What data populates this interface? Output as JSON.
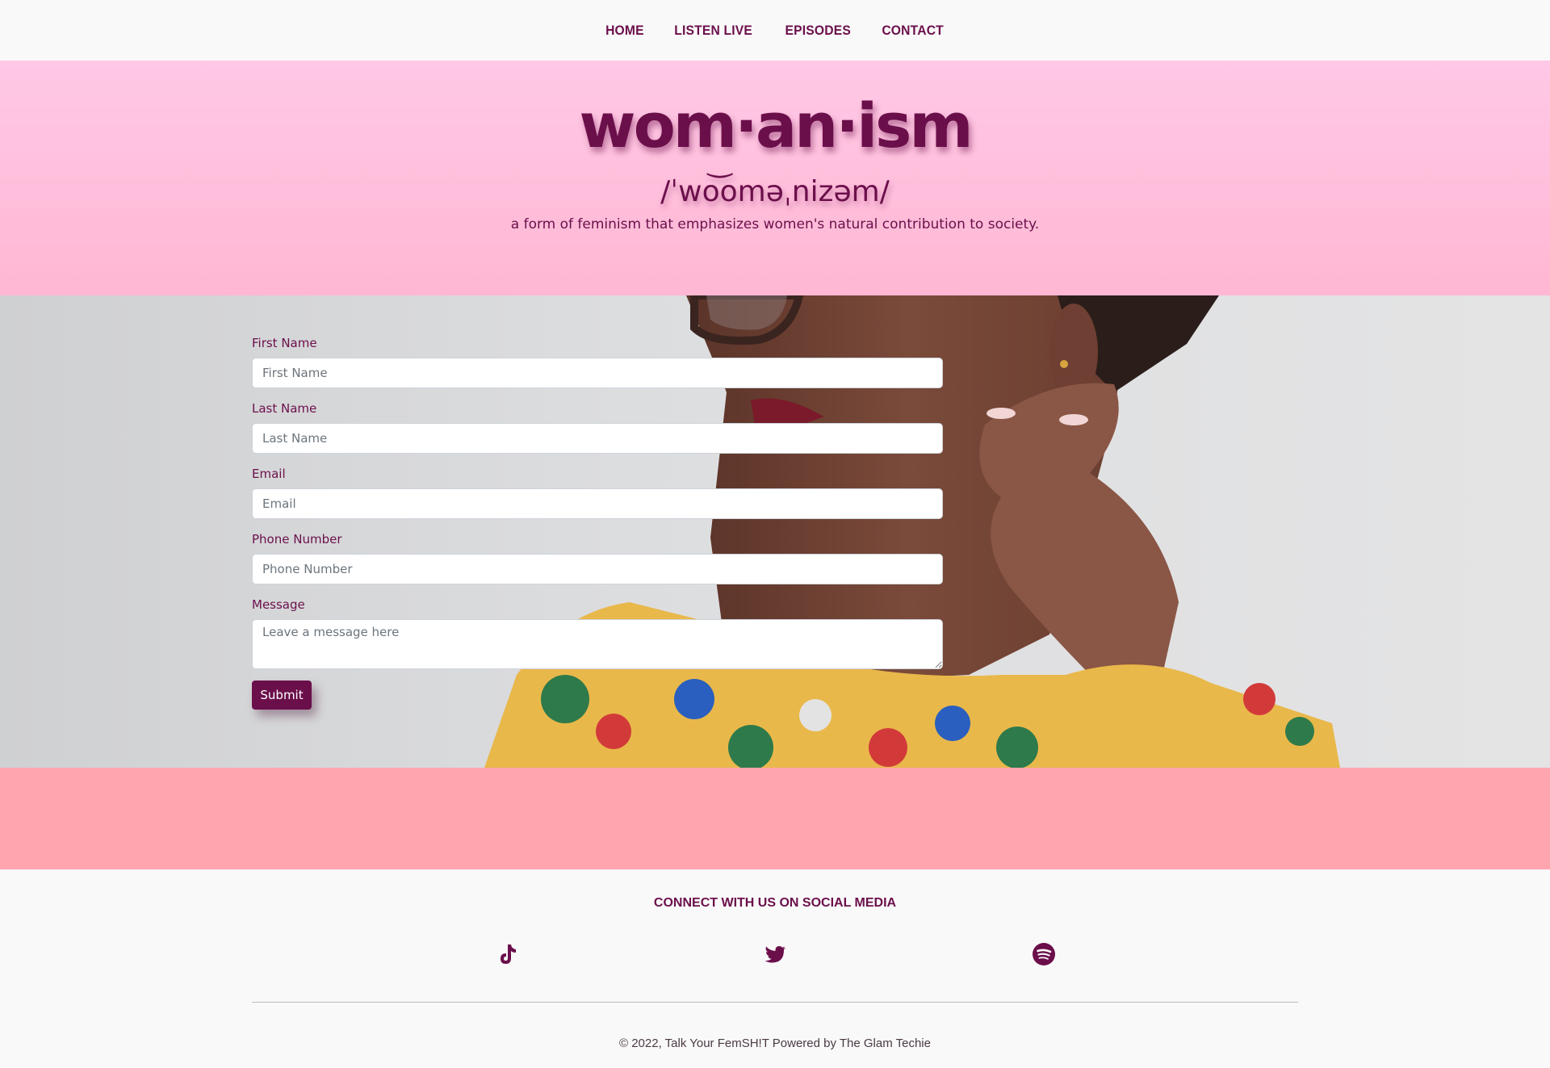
{
  "nav": {
    "items": [
      {
        "label": "HOME"
      },
      {
        "label": "LISTEN LIVE"
      },
      {
        "label": "EPISODES"
      },
      {
        "label": "CONTACT"
      }
    ]
  },
  "hero": {
    "word": "wom·an·ism",
    "pronunciation": "/ˈwo͝oməˌnizəm/",
    "definition": "a form of feminism that emphasizes women's natural contribution to society."
  },
  "form": {
    "first_name": {
      "label": "First Name",
      "placeholder": "First Name"
    },
    "last_name": {
      "label": "Last Name",
      "placeholder": "Last Name"
    },
    "email": {
      "label": "Email",
      "placeholder": "Email"
    },
    "phone": {
      "label": "Phone Number",
      "placeholder": "Phone Number"
    },
    "message": {
      "label": "Message",
      "placeholder": "Leave a message here"
    },
    "submit_label": "Submit"
  },
  "footer": {
    "heading": "CONNECT WITH US ON SOCIAL MEDIA",
    "socials": [
      {
        "icon": "tiktok-icon"
      },
      {
        "icon": "twitter-icon"
      },
      {
        "icon": "spotify-icon"
      }
    ],
    "copyright": "© 2022, Talk Your FemSH!T Powered by The Glam Techie"
  },
  "colors": {
    "brand": "#6b0f4b",
    "hero_pink": "#ffc4e4",
    "band_pink": "#ffa5b0",
    "background": "#f9f9f9"
  }
}
